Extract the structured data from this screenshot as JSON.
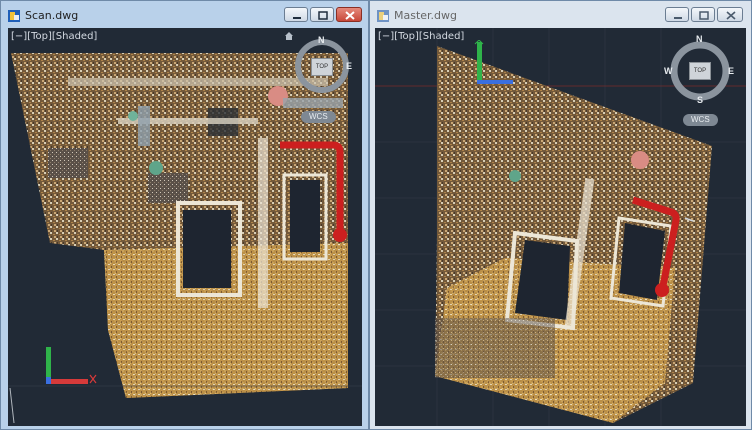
{
  "windows": [
    {
      "title": "Scan.dwg",
      "viewport_label": "[−][Top][Shaded]",
      "viewcube": {
        "north": "N",
        "south": "",
        "east": "E",
        "west": "",
        "top_face": "TOP",
        "coordinate_system": "WCS"
      },
      "buttons": [
        "minimize",
        "restore",
        "close"
      ]
    },
    {
      "title": "Master.dwg",
      "viewport_label": "[−][Top][Shaded]",
      "viewcube": {
        "north": "N",
        "south": "S",
        "east": "E",
        "west": "W",
        "top_face": "TOP",
        "coordinate_system": "WCS"
      },
      "buttons": [
        "minimize",
        "restore",
        "close"
      ]
    }
  ],
  "icons": {
    "app": "dwg-file-icon",
    "minimize": "minimize-icon",
    "restore": "restore-icon",
    "close": "close-icon",
    "home": "home-icon",
    "ucs": "ucs-axis-icon"
  },
  "colors": {
    "viewport_bg": "#212a36",
    "active_frame": "#b9d1ea",
    "inactive_frame": "#dbe4ee",
    "pipe_highlight": "#cc1f1f",
    "ucs_x": "#d63a3a",
    "ucs_y": "#2fb34a",
    "ucs_z": "#3a6fe0"
  }
}
